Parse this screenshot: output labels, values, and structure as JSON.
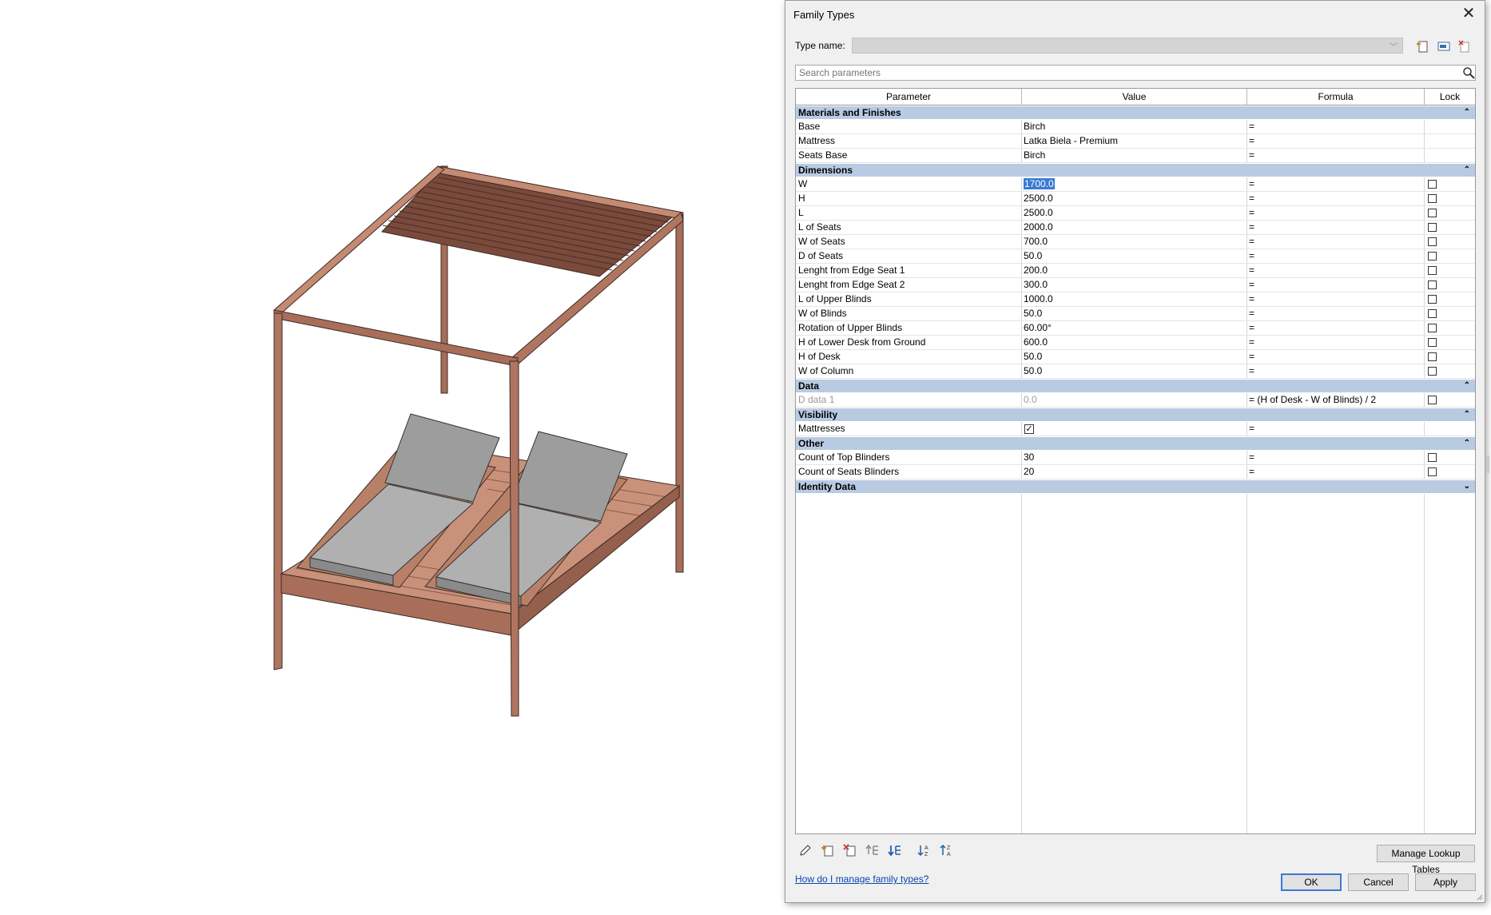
{
  "dialog": {
    "title": "Family Types",
    "type_name_label": "Type name:",
    "type_name_value": "",
    "search_placeholder": "Search parameters",
    "columns": [
      "Parameter",
      "Value",
      "Formula",
      "Lock"
    ],
    "groups": [
      {
        "name": "Materials and Finishes",
        "collapsed": false
      },
      {
        "name": "Dimensions",
        "collapsed": false
      },
      {
        "name": "Data",
        "collapsed": false
      },
      {
        "name": "Visibility",
        "collapsed": false
      },
      {
        "name": "Other",
        "collapsed": false
      },
      {
        "name": "Identity Data",
        "collapsed": true
      }
    ],
    "materials": [
      {
        "param": "Base",
        "value": "Birch",
        "formula": "="
      },
      {
        "param": "Mattress",
        "value": "Latka Biela - Premium",
        "formula": "="
      },
      {
        "param": "Seats Base",
        "value": "Birch",
        "formula": "="
      }
    ],
    "dimensions": [
      {
        "param": "W",
        "value": "1700.0",
        "formula": "="
      },
      {
        "param": "H",
        "value": "2500.0",
        "formula": "="
      },
      {
        "param": "L",
        "value": "2500.0",
        "formula": "="
      },
      {
        "param": "L of Seats",
        "value": "2000.0",
        "formula": "="
      },
      {
        "param": "W of Seats",
        "value": "700.0",
        "formula": "="
      },
      {
        "param": "D of Seats",
        "value": "50.0",
        "formula": "="
      },
      {
        "param": "Lenght from Edge Seat 1",
        "value": "200.0",
        "formula": "="
      },
      {
        "param": "Lenght from Edge Seat 2",
        "value": "300.0",
        "formula": "="
      },
      {
        "param": "L of Upper Blinds",
        "value": "1000.0",
        "formula": "="
      },
      {
        "param": "W of Blinds",
        "value": "50.0",
        "formula": "="
      },
      {
        "param": "Rotation of Upper Blinds",
        "value": "60.00°",
        "formula": "="
      },
      {
        "param": "H of Lower Desk from Ground",
        "value": "600.0",
        "formula": "="
      },
      {
        "param": "H of Desk",
        "value": "50.0",
        "formula": "="
      },
      {
        "param": "W of Column",
        "value": "50.0",
        "formula": "="
      }
    ],
    "data": [
      {
        "param": "D data 1",
        "value": "0.0",
        "formula": "= (H of Desk - W of Blinds) / 2"
      }
    ],
    "visibility": [
      {
        "param": "Mattresses",
        "checked": true,
        "formula": "="
      }
    ],
    "other": [
      {
        "param": "Count of Top Blinders",
        "value": "30",
        "formula": "="
      },
      {
        "param": "Count of Seats Blinders",
        "value": "20",
        "formula": "="
      }
    ],
    "manage_lookup_label": "Manage Lookup Tables",
    "help_link": "How do I manage family types?",
    "ok_label": "OK",
    "cancel_label": "Cancel",
    "apply_label": "Apply"
  },
  "model": {
    "description_icon": "daybed-3d-model",
    "wood_color": "#b98068",
    "cushion_color": "#9d9d9d"
  }
}
